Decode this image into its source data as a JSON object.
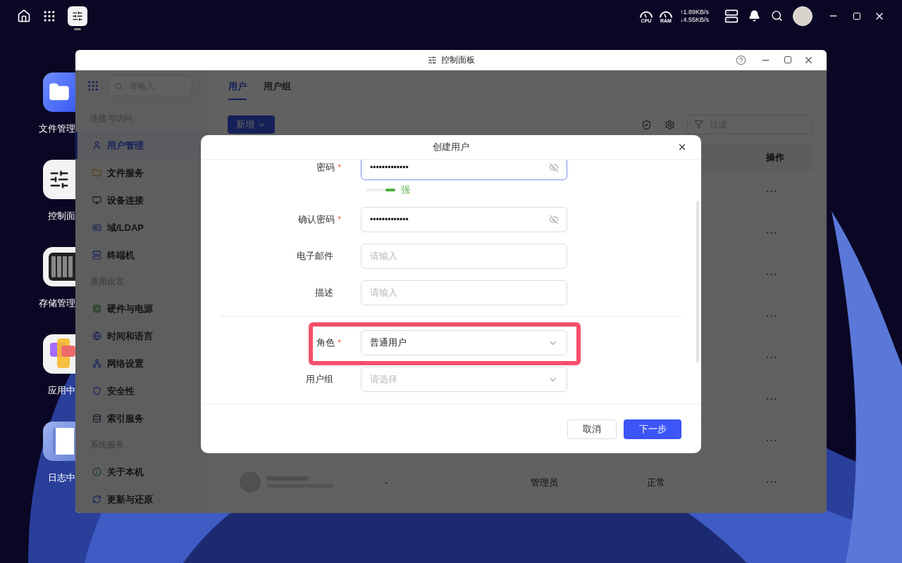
{
  "top_bar": {
    "cpu_label": "CPU",
    "ram_label": "RAM",
    "upload_speed": "↑1.89KB/s",
    "download_speed": "↓4.55KB/s"
  },
  "desktop_icons": [
    {
      "kind": "files",
      "label": "文件管理"
    },
    {
      "kind": "control",
      "label": "控制面"
    },
    {
      "kind": "storage",
      "label": "存储管理"
    },
    {
      "kind": "apps",
      "label": "应用中"
    },
    {
      "kind": "log",
      "label": "日志中"
    }
  ],
  "window": {
    "title": "控制面板",
    "search": {
      "placeholder": "请输入"
    },
    "sidebar": [
      {
        "heading": "连接与访问",
        "items": [
          {
            "label": "用户管理",
            "selected": true
          },
          {
            "label": "文件服务",
            "selected": false
          },
          {
            "label": "设备连接",
            "selected": false
          },
          {
            "label": "域/LDAP",
            "selected": false
          },
          {
            "label": "终端机",
            "selected": false
          }
        ]
      },
      {
        "heading": "通用设置",
        "items": [
          {
            "label": "硬件与电源",
            "selected": false
          },
          {
            "label": "时间和语言",
            "selected": false
          },
          {
            "label": "网络设置",
            "selected": false
          },
          {
            "label": "安全性",
            "selected": false
          },
          {
            "label": "索引服务",
            "selected": false
          }
        ]
      },
      {
        "heading": "系统服务",
        "items": [
          {
            "label": "关于本机",
            "selected": false
          },
          {
            "label": "更新与还原",
            "selected": false
          }
        ]
      }
    ],
    "tabs": [
      {
        "label": "用户",
        "selected": true
      },
      {
        "label": "用户组",
        "selected": false
      }
    ],
    "add_button": "新增",
    "filter": {
      "placeholder": "过滤"
    },
    "table": {
      "columns": [
        "操作"
      ],
      "rows": [
        {
          "actions": "···"
        },
        {
          "actions": "···"
        },
        {
          "actions": "···"
        },
        {
          "actions": "···"
        },
        {
          "actions": "···"
        },
        {
          "actions": "···"
        },
        {
          "actions": "···"
        },
        {
          "column_2": "-",
          "role": "管理员",
          "status": "正常",
          "actions": "···"
        }
      ]
    }
  },
  "dialog": {
    "title": "创建用户",
    "fields": [
      {
        "kind": "password",
        "label": "密码",
        "required_mark": "*",
        "value": "•••••••••••••",
        "focused": true,
        "strength": {
          "label": "强",
          "segments": [
            {
              "on": false
            },
            {
              "on": false
            },
            {
              "on": true
            }
          ]
        }
      },
      {
        "kind": "password",
        "label": "确认密码",
        "required_mark": "*",
        "value": "•••••••••••••",
        "focused": false
      },
      {
        "kind": "text",
        "label": "电子邮件",
        "placeholder": "请输入",
        "focused": false
      },
      {
        "kind": "text",
        "label": "描述",
        "placeholder": "请输入",
        "focused": false
      },
      {
        "kind": "divider"
      },
      {
        "kind": "select",
        "label": "角色",
        "required_mark": "*",
        "value": "普通用户",
        "highlighted": true
      },
      {
        "kind": "select",
        "label": "用户组",
        "placeholder": "请选择"
      }
    ],
    "cancel_button": "取消",
    "next_button": "下一步"
  }
}
